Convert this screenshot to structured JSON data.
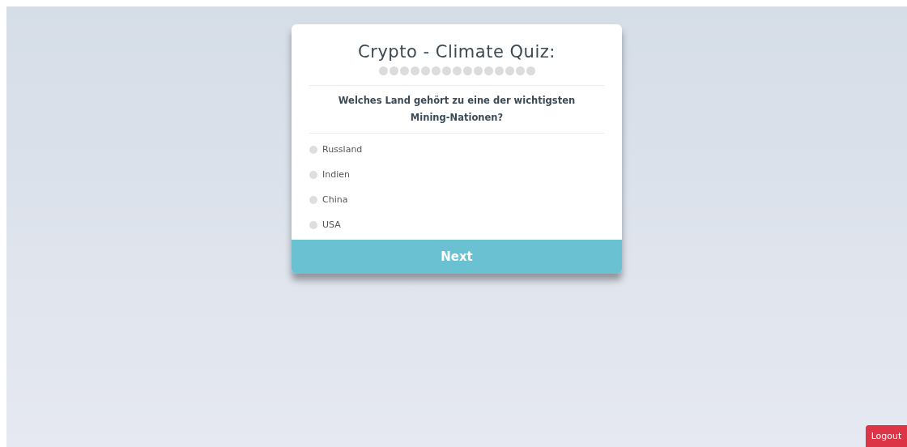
{
  "quiz": {
    "title": "Crypto - Climate Quiz:",
    "progress": [
      {
        "done": false
      },
      {
        "done": false
      },
      {
        "done": false
      },
      {
        "done": false
      },
      {
        "done": false
      },
      {
        "done": false
      },
      {
        "done": false
      },
      {
        "done": false
      },
      {
        "done": false
      },
      {
        "done": false
      },
      {
        "done": false
      },
      {
        "done": false
      },
      {
        "done": false
      },
      {
        "done": false
      },
      {
        "done": false
      }
    ],
    "question": "Welches Land gehört zu eine der wichtigsten Mining-Nationen?",
    "options": [
      {
        "label": "Russland",
        "selected": false
      },
      {
        "label": "Indien",
        "selected": false
      },
      {
        "label": "China",
        "selected": false
      },
      {
        "label": "USA",
        "selected": false
      }
    ],
    "next_button": "Next"
  },
  "logout_button": "Logout"
}
